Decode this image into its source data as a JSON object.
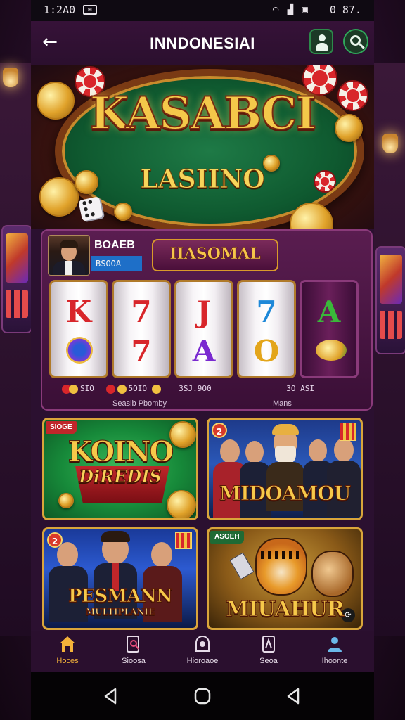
{
  "status_bar": {
    "time": "1:2A0",
    "mail_icon": "mail-icon",
    "signal": "wifi-signal-icons",
    "battery_text": "0 87."
  },
  "top_bar": {
    "title": "INNDONESIAI",
    "back_icon": "back-arrow-icon",
    "profile_icon": "user-icon",
    "search_icon": "search-icon"
  },
  "hero": {
    "title": "KASABCI",
    "subtitle": "LASIINO"
  },
  "slot": {
    "user_name": "BOAEB",
    "user_sub": "BSOOA",
    "logo": "IIASOMAL",
    "reels": [
      {
        "top": "K",
        "bottom": ""
      },
      {
        "top": "7",
        "bottom": "7"
      },
      {
        "top": "J",
        "bottom": "A"
      },
      {
        "top": "7",
        "bottom": "O"
      },
      {
        "top": "A",
        "bottom": ""
      }
    ],
    "row_values": [
      "SIO",
      "5OIO",
      "3SJ.9O0",
      "3O ASI"
    ],
    "footer_left": "Seasib Pbomby",
    "footer_right": "Mans"
  },
  "cards": [
    {
      "tag": "SIOGE",
      "title": "KOINO",
      "sub": "DiREDIS",
      "theme": "green"
    },
    {
      "tag": "2",
      "title": "MIDOAMOU",
      "theme": "blue"
    },
    {
      "tag": "2",
      "title": "PESMANN",
      "sub": "MULTIPLANIE",
      "theme": "navy"
    },
    {
      "tag": "ASOEH",
      "title": "MIUAHUR",
      "theme": "gold"
    }
  ],
  "nav": {
    "items": [
      {
        "label": "Hoces",
        "icon": "home-icon",
        "active": true
      },
      {
        "label": "Sioosa",
        "icon": "search-doc-icon",
        "active": false
      },
      {
        "label": "Hioroaoe",
        "icon": "circle-icon",
        "active": false
      },
      {
        "label": "Seoa",
        "icon": "card-icon",
        "active": false
      },
      {
        "label": "Ihoonte",
        "icon": "profile-icon",
        "active": false
      }
    ]
  },
  "system_nav": {
    "back": "back-triangle-icon",
    "home": "home-circle-icon",
    "recents": "recents-triangle-icon"
  },
  "colors": {
    "accent": "#f3b23a",
    "panel": "#3a0f36",
    "gold": "#d9a53a"
  }
}
